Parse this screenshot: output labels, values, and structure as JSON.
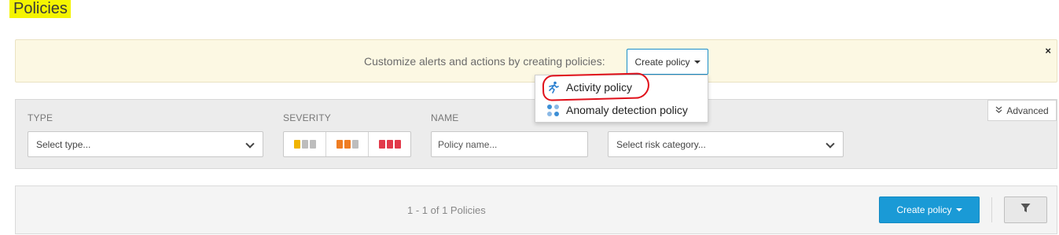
{
  "page": {
    "title": "Policies"
  },
  "banner": {
    "text": "Customize alerts and actions by creating policies:",
    "create_label": "Create policy",
    "close_glyph": "×"
  },
  "create_menu": {
    "items": [
      {
        "label": "Activity policy",
        "icon": "running-person-icon",
        "highlighted": true
      },
      {
        "label": "Anomaly detection policy",
        "icon": "dots-grid-icon"
      }
    ]
  },
  "filters": {
    "type": {
      "label": "TYPE",
      "placeholder": "Select type..."
    },
    "severity": {
      "label": "SEVERITY",
      "options": [
        "low",
        "medium",
        "high"
      ]
    },
    "name": {
      "label": "NAME",
      "placeholder": "Policy name..."
    },
    "risk": {
      "placeholder": "Select risk category..."
    },
    "advanced_label": "Advanced"
  },
  "results": {
    "count_text": "1 - 1 of 1 Policies",
    "create_label": "Create policy"
  },
  "colors": {
    "accent": "#1a9ad6",
    "banner_bg": "#fcf8e3",
    "title_highlight": "#f4f400",
    "severity_low": "#f0b400",
    "severity_medium": "#ef7d22",
    "severity_high": "#e23a4a",
    "annotation": "#e0101a"
  }
}
